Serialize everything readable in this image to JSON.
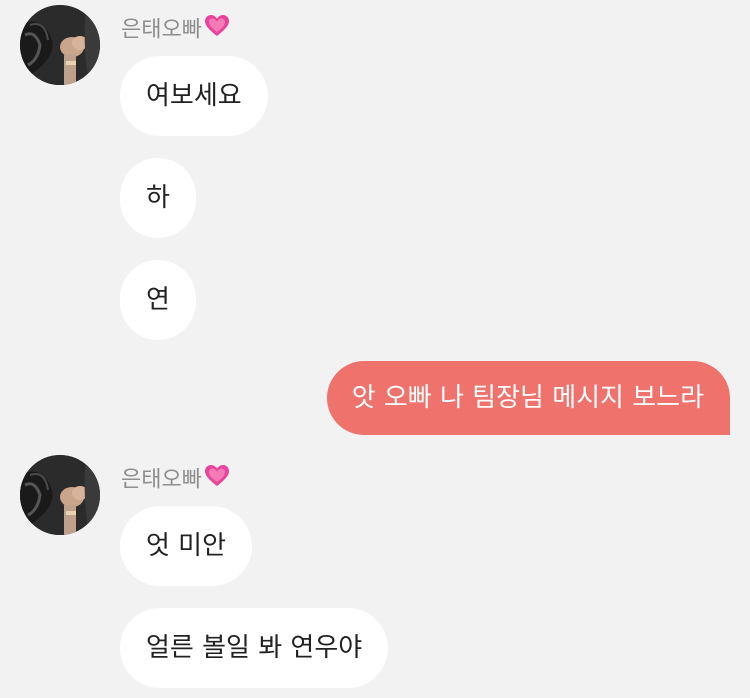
{
  "chat": {
    "sender_name": "은태오빠",
    "sender_heart": "💗",
    "messages": [
      {
        "text": "여보세요"
      },
      {
        "text": "하"
      },
      {
        "text": "연"
      },
      {
        "text": "앗 오빠 나 팀장님 메시지 보느라"
      },
      {
        "text": "엇 미안"
      },
      {
        "text": "얼른 볼일 봐 연우야"
      }
    ]
  },
  "colors": {
    "background": "#f2f2f2",
    "received_bubble": "#ffffff",
    "sent_bubble": "#ef726c",
    "sender_name": "#8e8e8e"
  }
}
